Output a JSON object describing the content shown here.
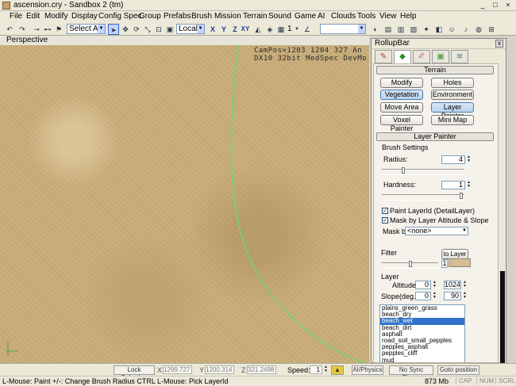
{
  "window": {
    "title": "ascension.cry - Sandbox 2 (tm)"
  },
  "menu": [
    "File",
    "Edit",
    "Modify",
    "Display",
    "Config Spec",
    "Group",
    "Prefabs",
    "Brush",
    "Mission",
    "Terrain",
    "Sound",
    "Game",
    "AI",
    "Clouds",
    "Tools",
    "View",
    "Help"
  ],
  "toolbar": {
    "select_filter": "Select All",
    "coord_system": "Local",
    "axes": [
      "X",
      "Y",
      "Z",
      "XY"
    ],
    "snap_value": "1",
    "search_value": ""
  },
  "viewport": {
    "label": "Perspective",
    "info_line1": "CamPos=1203 1204 327 An",
    "info_line2": "DX10 32bit MedSpec DevMo"
  },
  "rollup": {
    "title": "RollupBar",
    "close": "x",
    "terrain_header": "Terrain",
    "terrain_buttons": [
      "Modify",
      "Holes",
      "Vegetation",
      "Environment",
      "Move Area",
      "Layer Painter",
      "Voxel Painter",
      "Mini Map"
    ],
    "layer_painter_header": "Layer Painter",
    "brush_settings": "Brush Settings",
    "radius_label": "Radius:",
    "radius_value": "4",
    "hardness_label": "Hardness:",
    "hardness_value": "1",
    "paint_layer_id": "Paint LayerId (DetailLayer)",
    "mask_by_altitude": "Mask by Layer Altitude & Slope",
    "mask_by_label": "Mask by",
    "mask_by_value": "<none>",
    "filter_label": "Filter",
    "to_layer": "to Layer",
    "filter_value": "1",
    "layer_label": "Layer",
    "altitude_label": "Altitude",
    "altitude_min": "0",
    "altitude_max": "1024",
    "slope_label": "Slope(deg.)",
    "slope_min": "0",
    "slope_max": "90",
    "layers": [
      "plains_green_grass",
      "beach_dry",
      "beach_wet",
      "beach_dirt",
      "asphalt",
      "road_soil_small_pepples",
      "pepples_asphalt",
      "pepples_cliff",
      "mud"
    ],
    "selected_layer": "beach_wet"
  },
  "controls": {
    "lock_selection": "Lock Selection",
    "x_label": "X",
    "x_value": "1299.727",
    "y_label": "Y",
    "y_value": "1200.314",
    "z_label": "Z",
    "z_value": "321.2498",
    "speed_label": "Speed:",
    "speed_value": "1",
    "ai_physics": "AI/Physics",
    "no_sync_player": "No Sync Player",
    "goto_position": "Goto position"
  },
  "status": {
    "hint": "L-Mouse: Paint   +/-: Change Brush Radius   CTRL L-Mouse: Pick LayerId",
    "memory": "873 Mb",
    "cap": "CAP",
    "num": "NUM",
    "scrl": "SCRL"
  }
}
